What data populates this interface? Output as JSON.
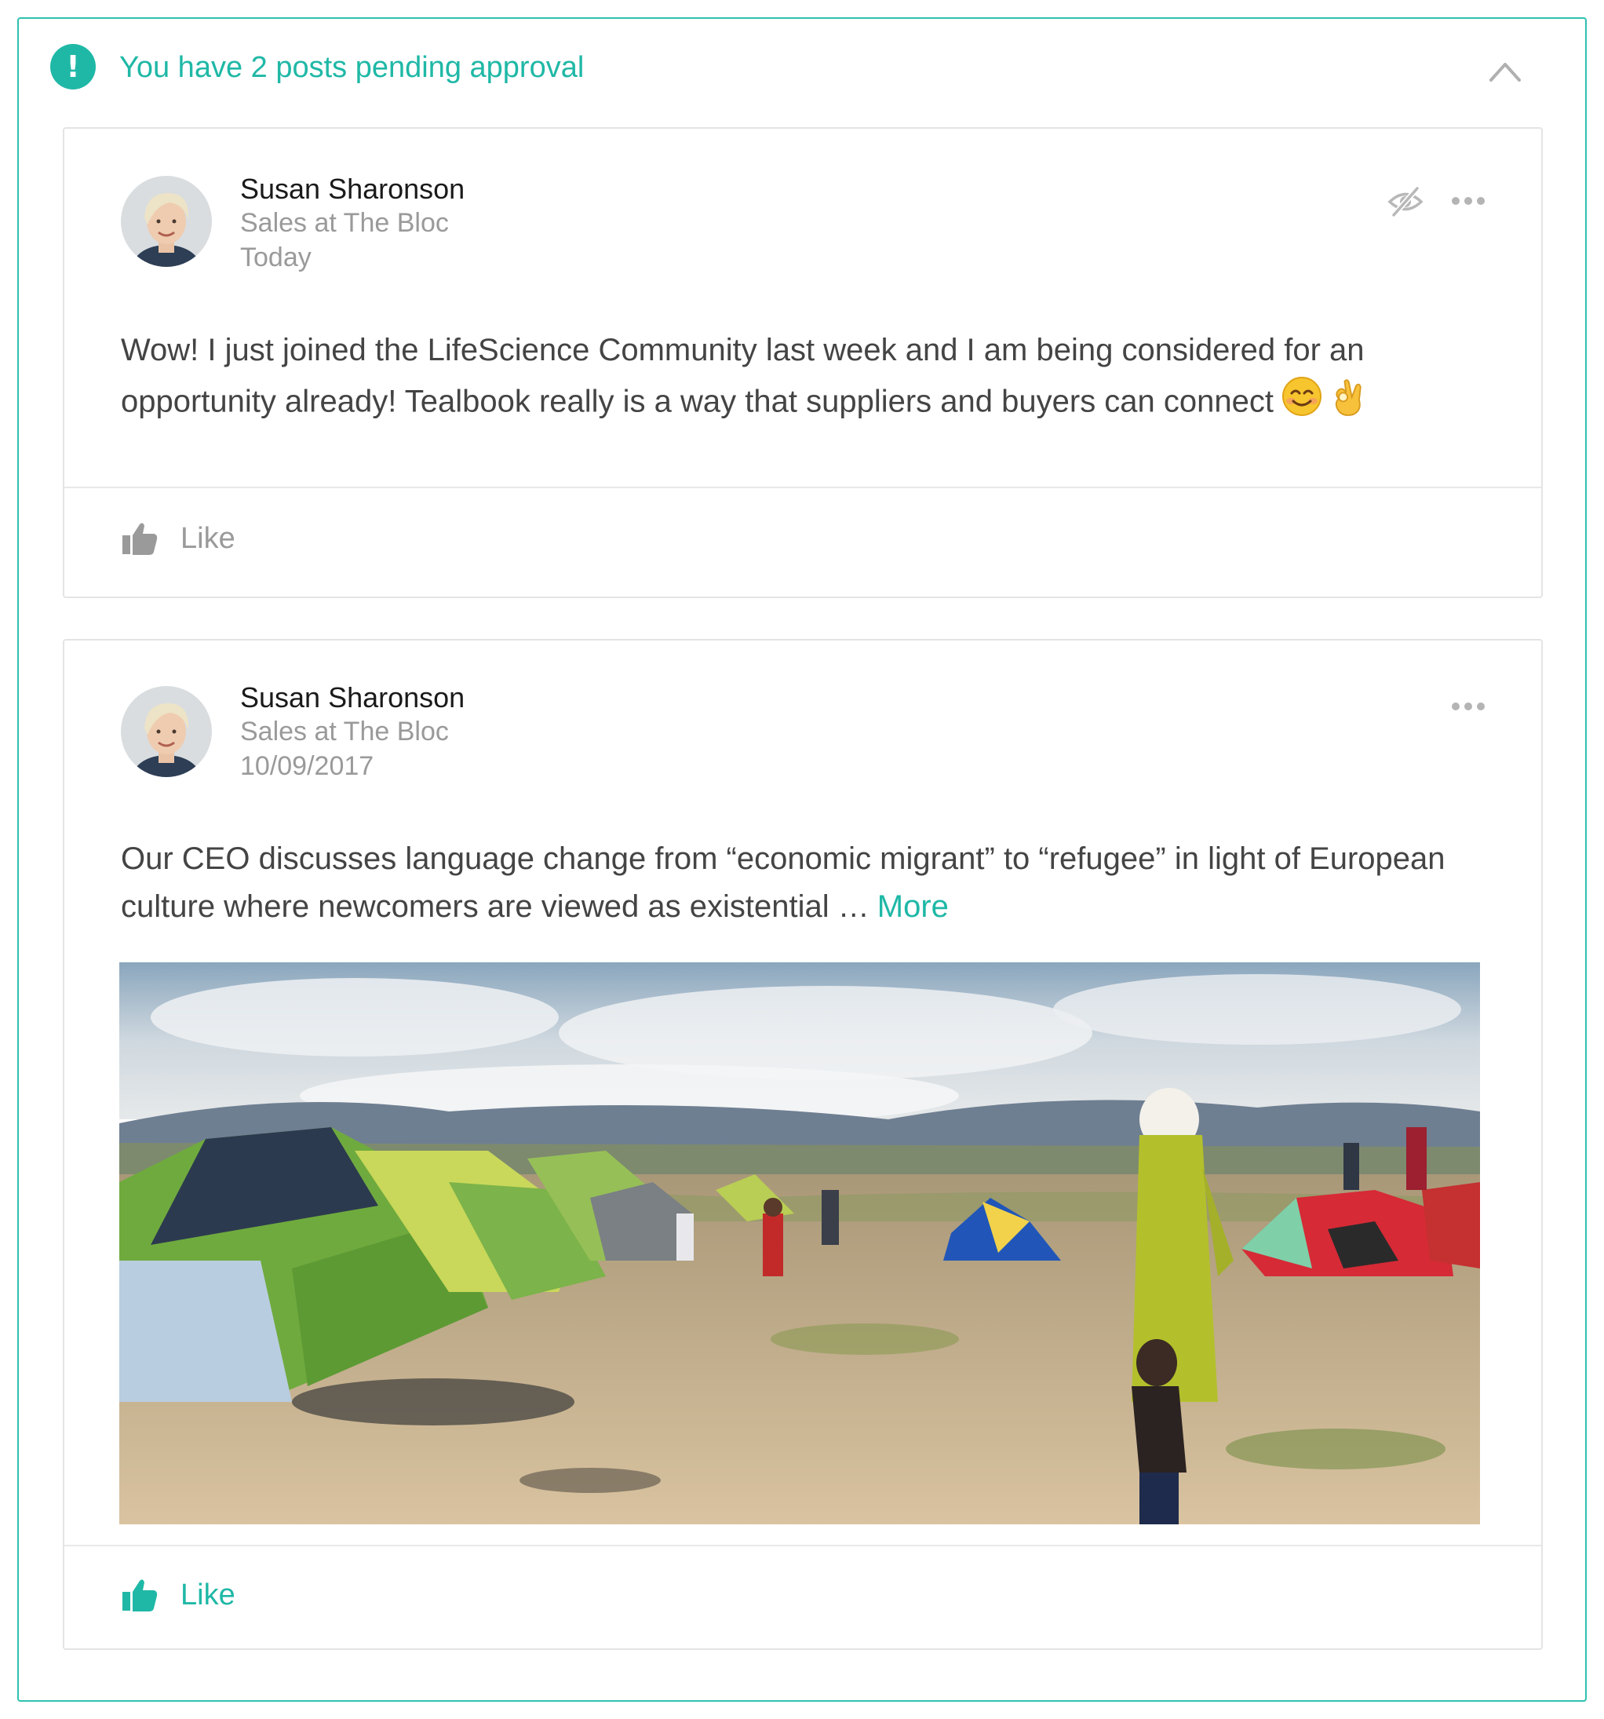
{
  "banner": {
    "message": "You have 2 posts pending approval",
    "alert_icon": "exclamation-circle-icon",
    "collapse_icon": "chevron-up-icon",
    "accent_color": "#1fb8a6"
  },
  "posts": [
    {
      "author": "Susan Sharonson",
      "role": "Sales at The Bloc",
      "date": "Today",
      "body": "Wow! I just joined the LifeScience Community last week and I am being considered for an opportunity already! Tealbook really is a way that suppliers and buyers can connect",
      "emojis": [
        "smiling-face-emoji",
        "ok-hand-emoji"
      ],
      "like_label": "Like",
      "liked": false,
      "icons": [
        "hidden-eye-icon",
        "more-options-icon"
      ]
    },
    {
      "author": "Susan Sharonson",
      "role": "Sales at The Bloc",
      "date": "10/09/2017",
      "body": "Our CEO discusses language change from “economic migrant” to “refugee” in light of European culture where newcomers are viewed as existential …",
      "more_label": "More",
      "like_label": "Like",
      "liked": true,
      "icons": [
        "more-options-icon"
      ],
      "image": "refugee-camp-tents-photo"
    }
  ]
}
